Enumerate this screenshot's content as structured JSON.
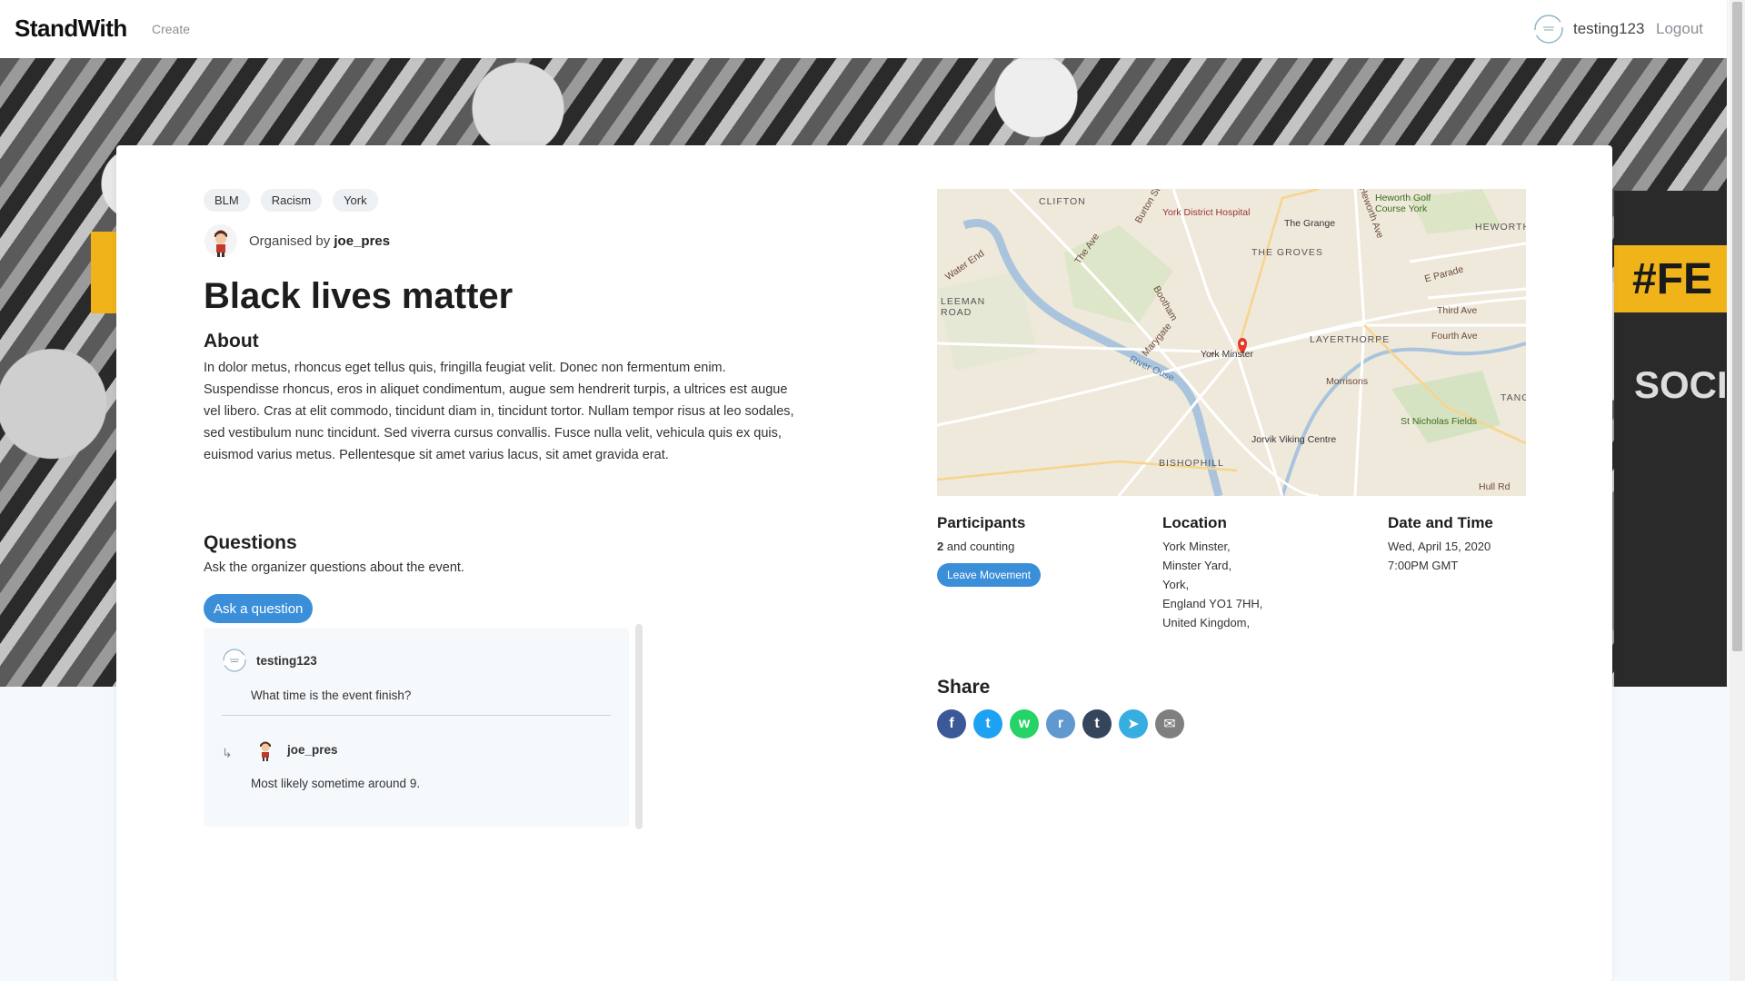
{
  "nav": {
    "brand": "StandWith",
    "create": "Create",
    "username": "testing123",
    "logout": "Logout"
  },
  "event": {
    "tags": [
      "BLM",
      "Racism",
      "York"
    ],
    "organised_by": "Organised by",
    "organiser": "joe_pres",
    "title": "Black lives matter",
    "about_heading": "About",
    "about_text": "In dolor metus, rhoncus eget tellus quis, fringilla feugiat velit. Donec non fermentum enim. Suspendisse rhoncus, eros in aliquet condimentum, augue sem hendrerit turpis, a ultrices est augue vel libero. Cras at elit commodo, tincidunt diam in, tincidunt tortor. Nullam tempor risus at leo sodales, sed vestibulum nunc tincidunt. Sed viverra cursus convallis. Fusce nulla velit, vehicula quis ex quis, euismod varius metus. Pellentesque sit amet varius lacus, sit amet gravida erat."
  },
  "hero": {
    "banner_text": "#FE",
    "banner_text2": "SOCI"
  },
  "questions": {
    "heading": "Questions",
    "subtitle": "Ask the organizer questions about the event.",
    "ask_button": "Ask a question",
    "items": [
      {
        "user": "testing123",
        "text": "What time is the event finish?",
        "reply_user": "joe_pres",
        "reply_text": "Most likely sometime around 9."
      }
    ]
  },
  "map": {
    "labels": {
      "clifton": "CLIFTON",
      "hospital": "York District Hospital",
      "grange": "The Grange",
      "golf": "Heworth Golf Course York",
      "heworth": "HEWORTH",
      "groves": "THE GROVES",
      "leeman": "LEEMAN ROAD",
      "layerthorpe": "LAYERTHORPE",
      "minster": "York Minster",
      "morrisons": "Morrisons",
      "nicholas": "St Nicholas Fields",
      "jorvik": "Jorvik Viking Centre",
      "bishophill": "BISHOPHILL",
      "water_end": "Water End",
      "river_ouse": "River Ouse",
      "bootham": "Bootham",
      "marygate": "Marygate",
      "burton": "Burton St",
      "the_ave": "The Ave",
      "east_parade": "E Parade",
      "third_ave": "Third Ave",
      "fourth_ave": "Fourth Ave",
      "hull_rd": "Hull Rd",
      "tang": "TANG",
      "heworth_ave": "Heworth Ave"
    }
  },
  "participants": {
    "heading": "Participants",
    "count": "2",
    "suffix": "and counting",
    "leave_button": "Leave Movement"
  },
  "location": {
    "heading": "Location",
    "lines": [
      "York Minster,",
      "Minster Yard,",
      "York,",
      "England YO1 7HH,",
      "United Kingdom,"
    ]
  },
  "datetime": {
    "heading": "Date and Time",
    "date": "Wed, April 15, 2020",
    "time": "7:00PM GMT"
  },
  "share": {
    "heading": "Share",
    "icons": [
      {
        "name": "facebook-icon",
        "color": "#3b5998",
        "glyph": "f"
      },
      {
        "name": "twitter-icon",
        "color": "#1da1f2",
        "glyph": "t"
      },
      {
        "name": "whatsapp-icon",
        "color": "#25d366",
        "glyph": "w"
      },
      {
        "name": "reddit-icon",
        "color": "#5f99cf",
        "glyph": "r"
      },
      {
        "name": "tumblr-icon",
        "color": "#35465c",
        "glyph": "t"
      },
      {
        "name": "telegram-icon",
        "color": "#37aee2",
        "glyph": "➤"
      },
      {
        "name": "email-icon",
        "color": "#7f7f7f",
        "glyph": "✉"
      }
    ]
  },
  "colors": {
    "accent": "#3b8fd9",
    "background": "#f5f9fc"
  }
}
